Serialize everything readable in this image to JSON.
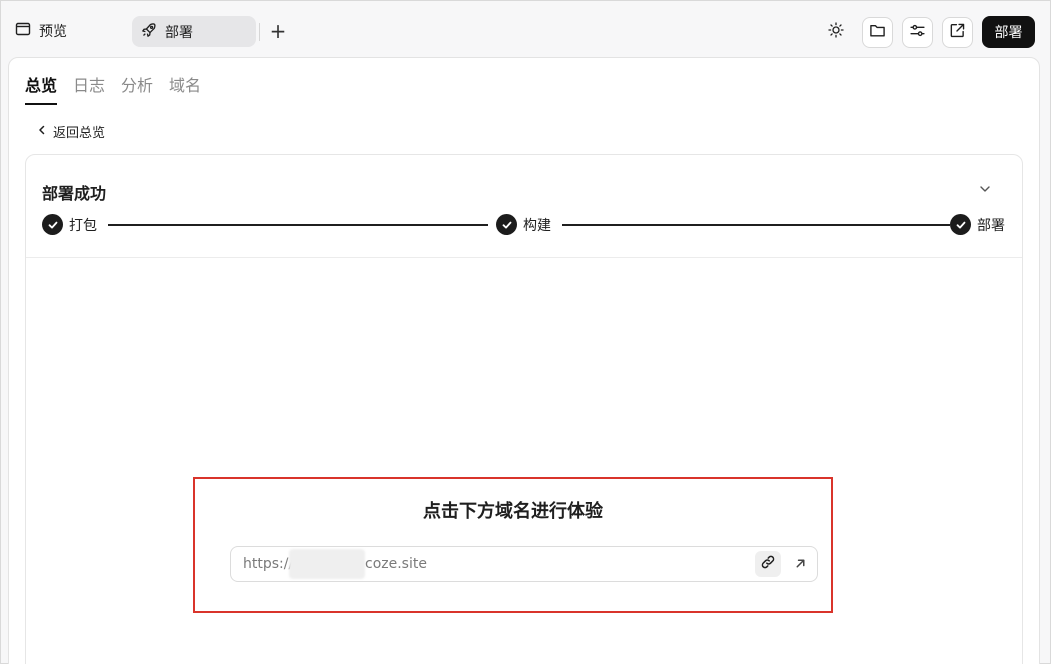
{
  "topbar": {
    "preview_label": "预览",
    "deploy_tab_label": "部署",
    "add_tab_symbol": "+",
    "deploy_button_label": "部署"
  },
  "tabs": [
    {
      "label": "总览",
      "active": true
    },
    {
      "label": "日志",
      "active": false
    },
    {
      "label": "分析",
      "active": false
    },
    {
      "label": "域名",
      "active": false
    }
  ],
  "back_link": "返回总览",
  "card": {
    "title": "部署成功",
    "steps": [
      {
        "label": "打包",
        "status": "done"
      },
      {
        "label": "构建",
        "status": "done"
      },
      {
        "label": "部署",
        "status": "done"
      }
    ]
  },
  "experience": {
    "title": "点击下方域名进行体验",
    "url_prefix": "https://",
    "url_suffix": "coze.site"
  },
  "colors": {
    "highlight_border": "#d9342b",
    "primary_dark": "#111111",
    "muted_text": "#8a8a8a"
  },
  "icons": {
    "preview": "browser-window-icon",
    "deploy": "rocket-icon",
    "theme": "sun-icon",
    "files": "folder-icon",
    "settings": "sliders-icon",
    "open_external": "external-link-icon",
    "back": "chevron-left-icon",
    "collapse": "chevron-down-icon",
    "copy": "link-icon",
    "open": "arrow-up-right-icon"
  }
}
